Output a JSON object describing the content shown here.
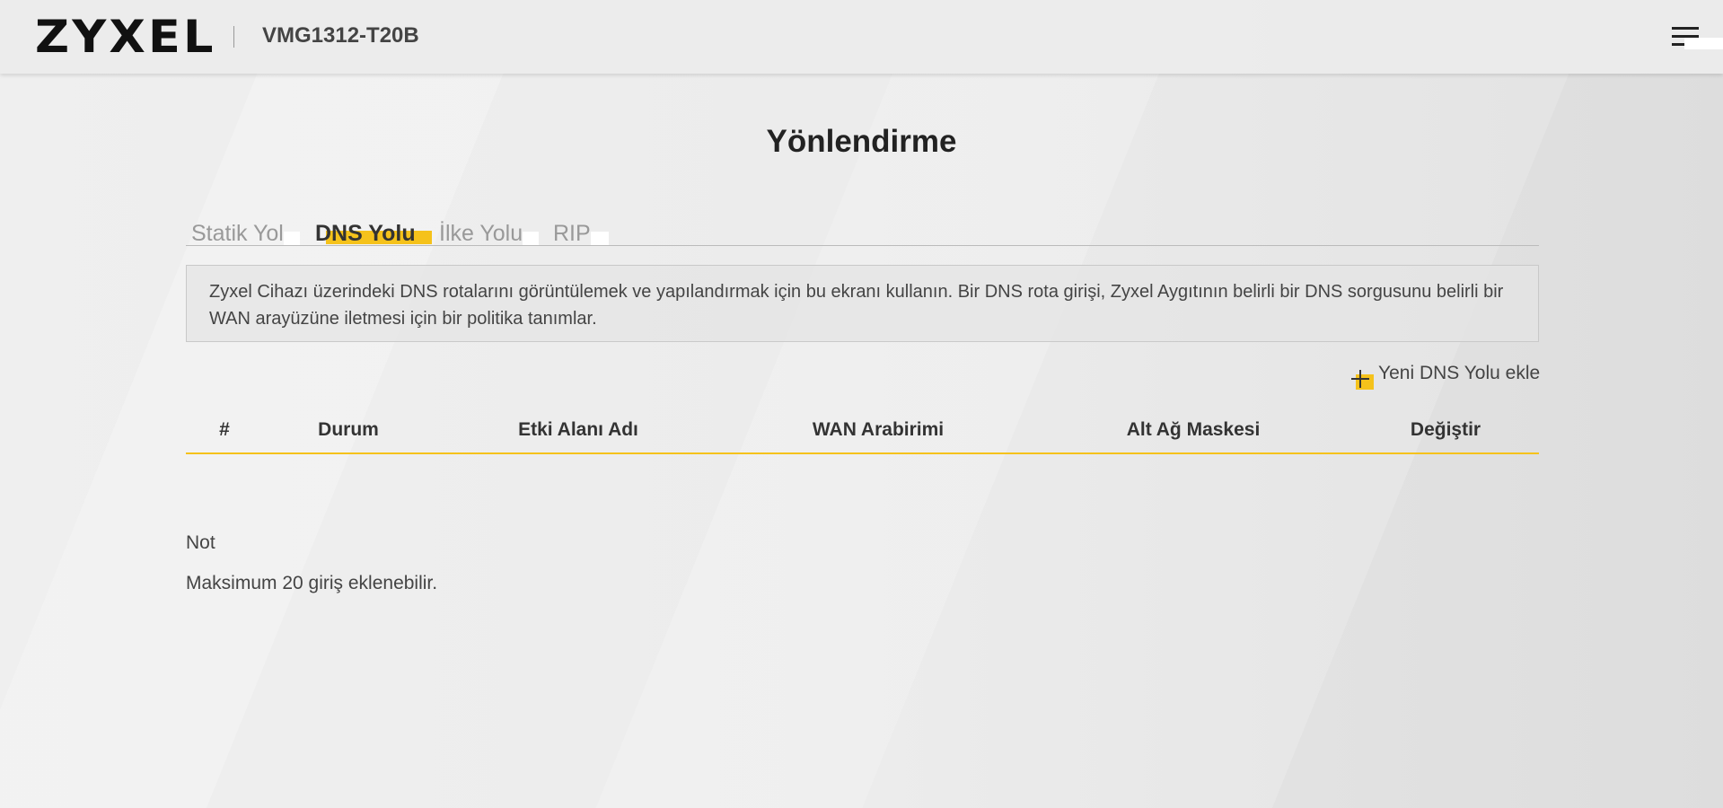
{
  "header": {
    "logo": "ZYXEL",
    "model": "VMG1312-T20B",
    "menu_icon": "hamburger-menu-icon"
  },
  "page": {
    "title": "Yönlendirme"
  },
  "tabs": [
    {
      "label": "Statik Yol",
      "active": false
    },
    {
      "label": "DNS Yolu",
      "active": true
    },
    {
      "label": "İlke Yolu",
      "active": false
    },
    {
      "label": "RIP",
      "active": false
    }
  ],
  "description": "Zyxel Cihazı üzerindeki DNS rotalarını görüntülemek ve yapılandırmak için bu ekranı kullanın. Bir DNS rota girişi, Zyxel Aygıtının belirli bir DNS sorgusunu belirli bir WAN arayüzüne iletmesi için bir politika tanımlar.",
  "add_button": {
    "label": "Yeni DNS Yolu ekle",
    "icon": "plus-icon"
  },
  "table": {
    "columns": [
      "#",
      "Durum",
      "Etki Alanı Adı",
      "WAN Arabirimi",
      "Alt Ağ Maskesi",
      "Değiştir"
    ],
    "rows": []
  },
  "note": {
    "title": "Not",
    "text": "Maksimum 20 giriş eklenebilir."
  },
  "colors": {
    "accent": "#f5c21b",
    "text": "#333333",
    "muted_tab": "#999999"
  }
}
